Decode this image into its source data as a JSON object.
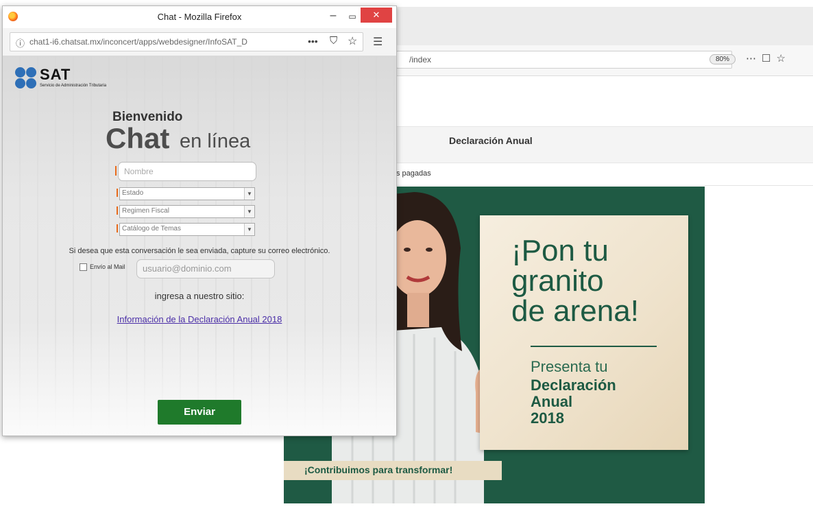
{
  "popup": {
    "window_title": "Chat - Mozilla Firefox",
    "url": "chat1-i6.chatsat.mx/inconcert/apps/webdesigner/InfoSAT_D",
    "logo": {
      "word": "SAT",
      "subtitle": "Servicio de Administración Tributaria"
    },
    "welcome": "Bienvenido",
    "chat_word": "Chat",
    "online_word": "en línea",
    "form": {
      "name_placeholder": "Nombre",
      "estado": "Estado",
      "regimen": "Regimen Fiscal",
      "catalogo": "Catálogo de Temas",
      "email_note": "Si desea que esta conversación le sea enviada, capture su correo electrónico.",
      "send_mail_label": "Envío al Mail",
      "email_placeholder": "usuario@dominio.com",
      "visit_text": "ingresa a nuestro sitio:",
      "info_link": "Información de la Declaración Anual 2018",
      "submit_label": "Enviar"
    }
  },
  "background_browser": {
    "url_fragment": "/index",
    "zoom": "80%",
    "nav_title": "Declaración Anual",
    "sub_text": "s pagadas",
    "banner": {
      "headline": "¡Pon tu\ngranito\nde arena!",
      "presenta": "Presenta tu",
      "declaracion": "Declaración\nAnual\n2018",
      "tagline": "¡Contribuimos para transformar!"
    }
  },
  "colors": {
    "banner_green": "#1f5a44",
    "submit_green": "#1f7a2b",
    "close_red": "#e04343",
    "sat_blue": "#2e6fb7"
  }
}
